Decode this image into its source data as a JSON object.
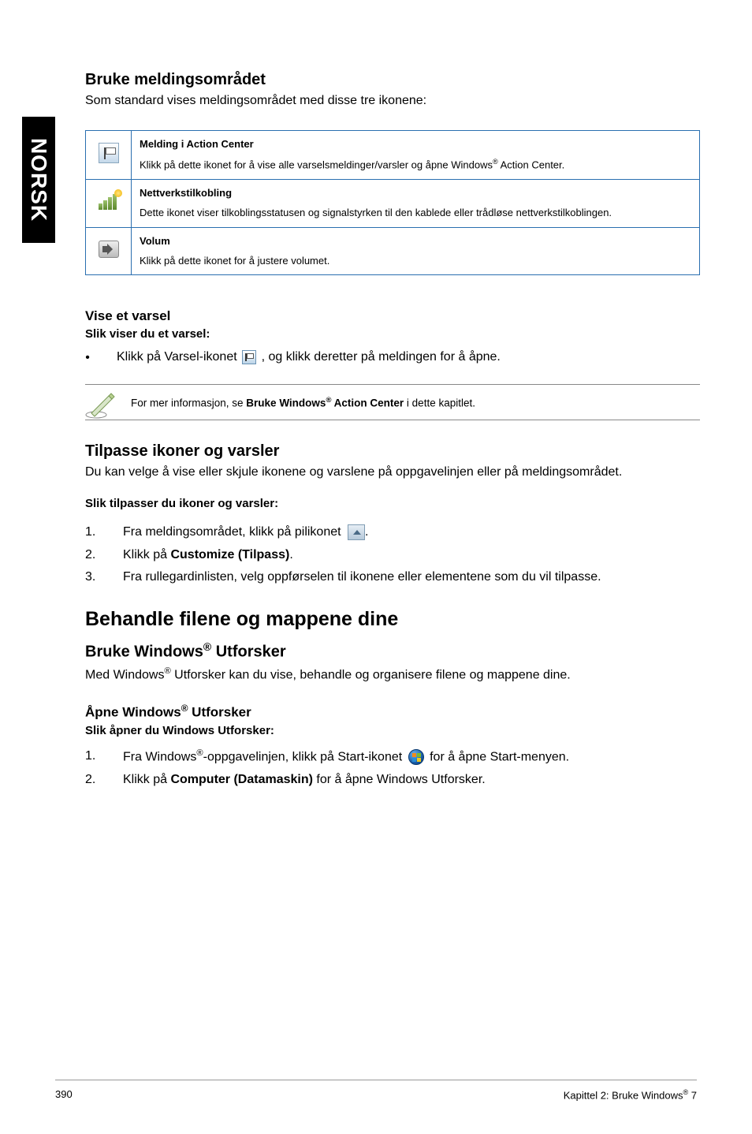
{
  "sideTab": "NORSK",
  "s1": {
    "heading": "Bruke meldingsområdet",
    "intro": "Som standard vises meldingsområdet med disse tre ikonene:",
    "rows": [
      {
        "title": "Melding i Action Center",
        "body_a": "Klikk på dette ikonet for å vise alle varselsmeldinger/varsler og åpne Windows",
        "body_b": " Action Center."
      },
      {
        "title": "Nettverkstilkobling",
        "body": "Dette ikonet viser tilkoblingsstatusen og signalstyrken til den kablede eller trådløse nettverkstilkoblingen."
      },
      {
        "title": "Volum",
        "body": "Klikk på dette ikonet for å justere volumet."
      }
    ]
  },
  "s2": {
    "heading": "Vise et varsel",
    "sub": "Slik viser du et varsel:",
    "bullet_a": "Klikk på Varsel-ikonet ",
    "bullet_b": ", og klikk deretter på meldingen for å åpne.",
    "note_a": "For mer informasjon, se ",
    "note_bold_a": "Bruke Windows",
    "note_bold_b": " Action Center",
    "note_b": " i dette kapitlet."
  },
  "s3": {
    "heading": "Tilpasse ikoner og varsler",
    "intro": "Du kan velge å vise eller skjule ikonene og varslene på oppgavelinjen eller på meldingsområdet.",
    "sub": "Slik tilpasser du ikoner og varsler:",
    "step1": "Fra meldingsområdet, klikk på pilikonet ",
    "step1_end": ".",
    "step2_a": "Klikk på ",
    "step2_bold": "Customize (Tilpass)",
    "step2_b": ".",
    "step3": "Fra rullegardinlisten, velg oppførselen til ikonene eller elementene som du vil tilpasse."
  },
  "s4": {
    "bigHeading": "Behandle filene og mappene dine",
    "heading_a": "Bruke Windows",
    "heading_b": " Utforsker",
    "intro_a": "Med Windows",
    "intro_b": " Utforsker kan du vise, behandle og organisere filene og mappene dine.",
    "sub_a": "Åpne Windows",
    "sub_b": " Utforsker",
    "subsub": "Slik åpner du Windows Utforsker:",
    "step1_a": "Fra Windows",
    "step1_b": "-oppgavelinjen, klikk på Start-ikonet ",
    "step1_c": " for å åpne Start-menyen.",
    "step2_a": "Klikk på ",
    "step2_bold": "Computer (Datamaskin)",
    "step2_b": " for å åpne Windows Utforsker."
  },
  "footer": {
    "page": "390",
    "right_a": "Kapittel 2: Bruke Windows",
    "right_b": " 7"
  },
  "reg": "®"
}
